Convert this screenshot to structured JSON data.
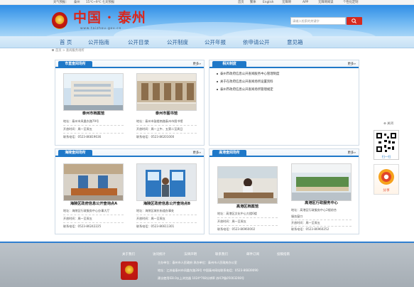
{
  "topbar": {
    "weather_label": "天气预报：",
    "city": "泰州",
    "weather": "15℃~9℃  七天预报",
    "links": [
      "首页",
      "繁体",
      "English",
      "无障碍",
      "APP",
      "无障碍阅读",
      "个性化定制"
    ]
  },
  "header": {
    "logo_text": "中国 · 泰州",
    "logo_url": "www.taizhou.gov.cn",
    "search_placeholder": "请输入检索的关键字"
  },
  "nav": [
    "首  页",
    "公开指南",
    "公开目录",
    "公开制度",
    "公开年报",
    "依申请公开",
    "意见箱"
  ],
  "breadcrumb": "首页 > 查阅服务场所",
  "panels": {
    "city": {
      "title": "市直查阅场所",
      "more": "更多»",
      "items": [
        {
          "name": "泰州市档案馆",
          "address": "地址：泰州市凤凰东路79号",
          "hours": "开放时间：周一至周五",
          "phone": "联系电话：0523-86819636"
        },
        {
          "name": "泰州市图书馆",
          "address": "地址：泰州市鼓楼南路泰州市图书馆",
          "hours": "开放时间：周一上午、五第二至周日",
          "phone": "联系电话：0523-86201000"
        }
      ]
    },
    "policy": {
      "title": "相关制度",
      "more": "更多»",
      "items": [
        "泰州市政府信息公开查阅服务中心管理制度",
        "关于在政府信息公开查阅场所设置资料",
        "泰州市政府信息公开查阅场所管理规定"
      ]
    },
    "hailing": {
      "title": "海陵查阅场所",
      "more": "更多»",
      "items": [
        {
          "name": "海陵区政府信息公开查询点A",
          "address": "地址：海陵区行政服务中心办事大厅",
          "hours": "开放时间：周一至周五",
          "phone": "联系电话：0523-86242225"
        },
        {
          "name": "海陵区政府信息公开查询点B",
          "address": "地址：海陵区城东街道办事处",
          "hours": "开放时间：周一至周五",
          "phone": "联系电话：0523-86611301"
        }
      ]
    },
    "gaogang": {
      "title": "高港查阅场所",
      "more": "更多»",
      "items": [
        {
          "name": "高港区档案馆",
          "address": "地址：高港区文化中心大楼6楼",
          "hours": "开放时间：周一至周五",
          "phone": "联系电话：0523-86960002"
        },
        {
          "name": "高港区行政服务中心",
          "address": "地址：高港区行政服务中心2楼综合",
          "extra": "服务窗口",
          "hours": "开放时间：周一至周五",
          "phone": "联系电话：0523-86960252"
        }
      ]
    }
  },
  "sidebar": {
    "close": "关闭",
    "qr_caption": "扫一扫",
    "share": "分享"
  },
  "footer": {
    "links": [
      "关于我们",
      "访问统计",
      "法律声明",
      "联系我们",
      "邮件订阅",
      "投稿指南"
    ],
    "sponsor": "主办单位：泰州市人民政府  承办单位：泰州市人民政府办公室",
    "address": "地址：江苏省泰州市凤凰东路28号  中国泰州网站联系电话：0523-86839090",
    "icp": "建议使用IE8.0以上浏览器 1024*768分辨率  苏ICP备05003208号"
  },
  "colors": {
    "accent": "#1f78c8",
    "brand_red": "#d9261c",
    "nav_text": "#2a5f98"
  }
}
